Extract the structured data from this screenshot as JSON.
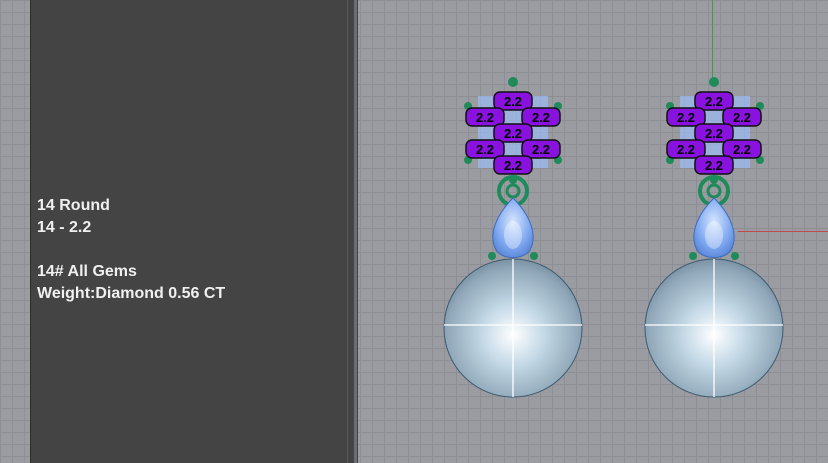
{
  "info": {
    "line1": "14 Round",
    "line2": "14 - 2.2",
    "line3": "14# All Gems",
    "line4": "Weight:Diamond 0.56 CT"
  },
  "gem_label": "2.2",
  "colors": {
    "panel": "#444444",
    "viewport": "#9b9ca2",
    "gem_tag": "#8a12e0",
    "prong": "#1f8a5a",
    "stone": "#8fb6ff",
    "pearl": "#a9c3d6"
  },
  "earrings": [
    {
      "name": "left",
      "tags": [
        "2.2",
        "2.2",
        "2.2",
        "2.2",
        "2.2",
        "2.2",
        "2.2"
      ]
    },
    {
      "name": "right",
      "tags": [
        "2.2",
        "2.2",
        "2.2",
        "2.2",
        "2.2",
        "2.2",
        "2.2"
      ]
    }
  ]
}
